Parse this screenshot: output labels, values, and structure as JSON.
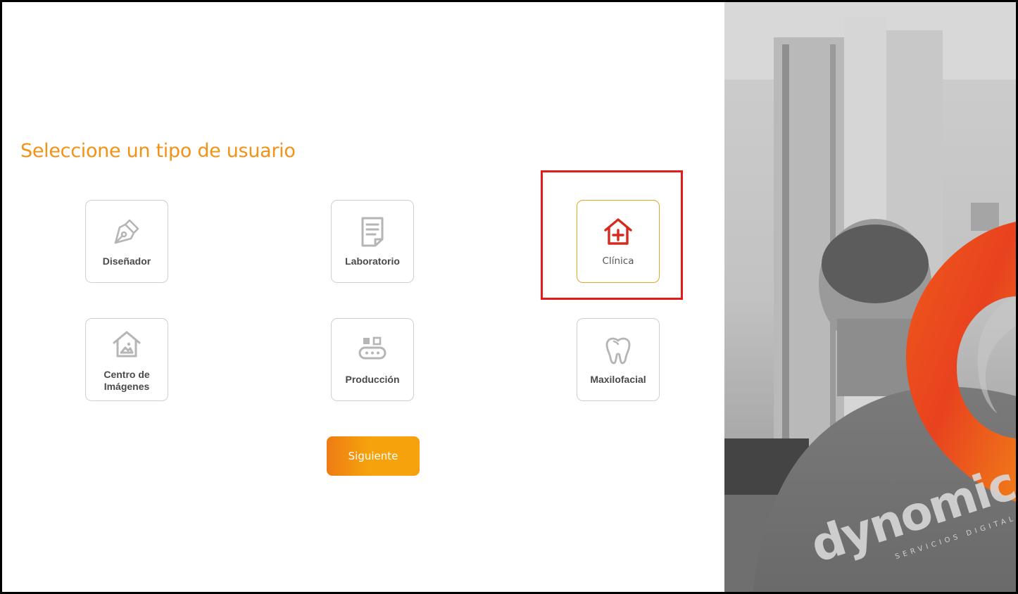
{
  "page_title": "Seleccione un tipo de usuario",
  "user_types": [
    {
      "label": "Diseñador",
      "icon": "pen-nib-icon",
      "selected": false
    },
    {
      "label": "Laboratorio",
      "icon": "document-icon",
      "selected": false
    },
    {
      "label": "Clínica",
      "icon": "clinic-house-plus-icon",
      "selected": true
    },
    {
      "label_line1": "Centro de",
      "label_line2": "Imágenes",
      "icon": "image-house-icon",
      "selected": false
    },
    {
      "label": "Producción",
      "icon": "production-machine-icon",
      "selected": false
    },
    {
      "label": "Maxilofacial",
      "icon": "tooth-icon",
      "selected": false
    }
  ],
  "next_button": {
    "label": "Siguiente"
  },
  "brand": {
    "name": "dynomic",
    "tagline": "SERVICIOS DIGITALES"
  },
  "colors": {
    "accent": "#f39214",
    "selected_border": "#e0a727",
    "selected_icon": "#d42a1f",
    "highlight_box": "#e11a1a",
    "icon_gray": "#b5b5b5"
  }
}
